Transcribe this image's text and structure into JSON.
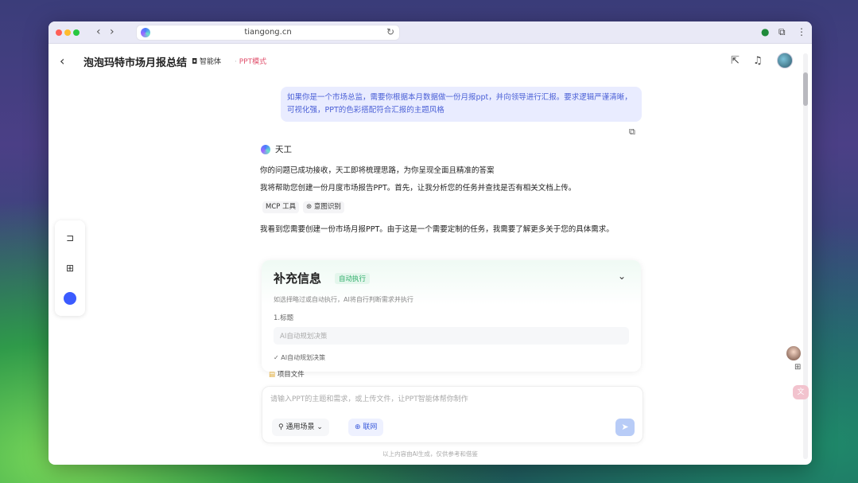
{
  "browser": {
    "url": "tiangong.cn",
    "nav_back": "‹",
    "nav_forward": "›",
    "reload": "↻"
  },
  "header": {
    "back": "‹",
    "title": "泡泡玛特市场月报总结",
    "agent_label": "智能体",
    "mode_label": "PPT模式"
  },
  "chat": {
    "user_message": "如果你是一个市场总监，需要你根据本月数据做一份月报ppt，并向领导进行汇报。要求逻辑严谨清晰，可视化强，PPT的色彩搭配符合汇报的主题风格",
    "bot_name": "天工",
    "bot_line1": "你的问题已成功接收，天工即将梳理思路，为你呈现全面且精准的答案",
    "bot_line2": "我将帮助您创建一份月度市场报告PPT。首先，让我分析您的任务并查找是否有相关文档上传。",
    "tools": [
      "MCP 工具",
      "意图识别"
    ],
    "bot_line3": "我看到您需要创建一份市场月报PPT。由于这是一个需要定制的任务，我需要了解更多关于您的具体需求。"
  },
  "card": {
    "title": "补充信息",
    "badge": "自动执行",
    "description": "如选择略过或自动执行，AI将自行判断需求并执行",
    "field_label": "1.标题",
    "field_placeholder": "AI自动规划决策",
    "check_label": "AI自动规划决策",
    "files_label": "项目文件"
  },
  "composer": {
    "placeholder": "请输入PPT的主题和需求，或上传文件，让PPT智能体帮你制作",
    "scene_label": "通用场景",
    "web_label": "联网"
  },
  "footer": {
    "disclaimer": "以上内容由AI生成，仅供参考和借鉴"
  }
}
